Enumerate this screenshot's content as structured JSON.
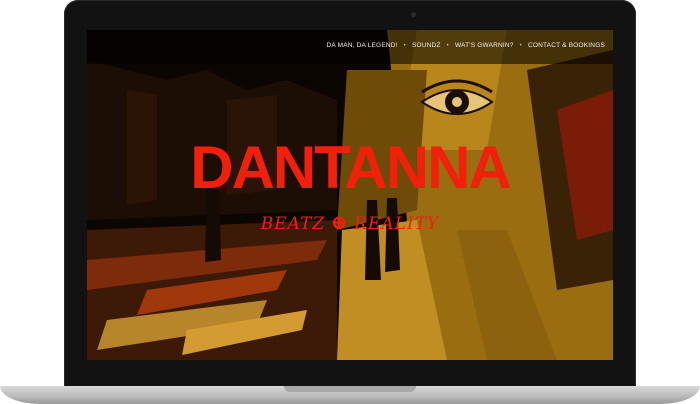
{
  "site": {
    "logo_text": "DANTANNA",
    "tagline": "BEATZ ☻ REALITY"
  },
  "nav": {
    "items": [
      {
        "label": "DA MAN, DA LEGEND!"
      },
      {
        "label": "SOUNDZ"
      },
      {
        "label": "WAT'S GWARNIN?"
      },
      {
        "label": "CONTACT & BOOKINGS"
      }
    ],
    "separator": "•"
  },
  "colors": {
    "accent": "#f2200b",
    "art_gold": "#a67812",
    "art_dark": "#140b04",
    "art_red": "#6a1606"
  },
  "icons": {
    "eye": "eye-icon",
    "smiley": "smiley-icon"
  }
}
